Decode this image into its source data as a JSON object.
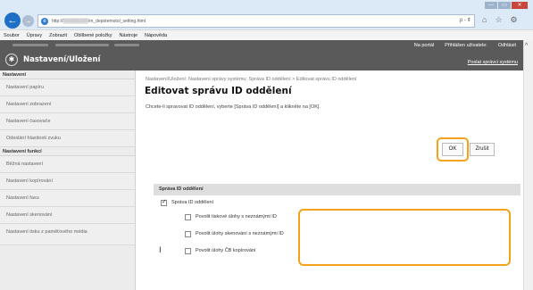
{
  "browser": {
    "url": "http://▒▒▒▒▒▒▒▒/m_depotemotol_setting.html",
    "addr_icons": "ρ - ¢",
    "window_buttons": {
      "minimize": "—",
      "maximize": "▭",
      "close": "✕"
    },
    "menu": [
      "Soubor",
      "Úpravy",
      "Zobrazit",
      "Oblíbené položky",
      "Nástroje",
      "Nápověda"
    ]
  },
  "header": {
    "portal": "Na portál",
    "login_label": "Přihlášen uživatele:",
    "logout": "Odhlásit",
    "title": "Nastavení/Uložení",
    "system_link": "Poslat správci systému"
  },
  "sidebar": {
    "section1": "Nastavení",
    "items1": [
      "Nastavení papíru",
      "Nastavení zobrazení",
      "Nastavení časovače",
      "Odeslání hlasitosti zvuku"
    ],
    "section2": "Nastavení funkcí",
    "items2": [
      "Běžná nastavení",
      "Nastavení kopírování",
      "Nastavení faxu",
      "Nastavení skenování",
      "Nastavení tisku z paměťového média"
    ]
  },
  "main": {
    "breadcrumb": "Nastavení/Uložení: Nastavení správy systému: Správa ID oddělení > Editovat správu ID oddělení",
    "title": "Editovat správu ID oddělení",
    "instruction": "Chcete-li spravovat ID oddělení, vyberte [Správa ID oddělení] a klikněte na [OK].",
    "ok": "OK",
    "cancel": "Zrušit",
    "section_title": "Správa ID oddělení",
    "main_option": "Správa ID oddělení",
    "options": [
      "Povolit tiskové úlohy s neznámými ID",
      "Povolit úlohy skenování s neznámými ID",
      "Povolit úlohy ČB kopírování"
    ],
    "cursor": "I"
  },
  "colors": {
    "highlight": "#f2a21b",
    "header_bg": "#5a5a5a",
    "chrome_bg": "#dce9f7"
  }
}
